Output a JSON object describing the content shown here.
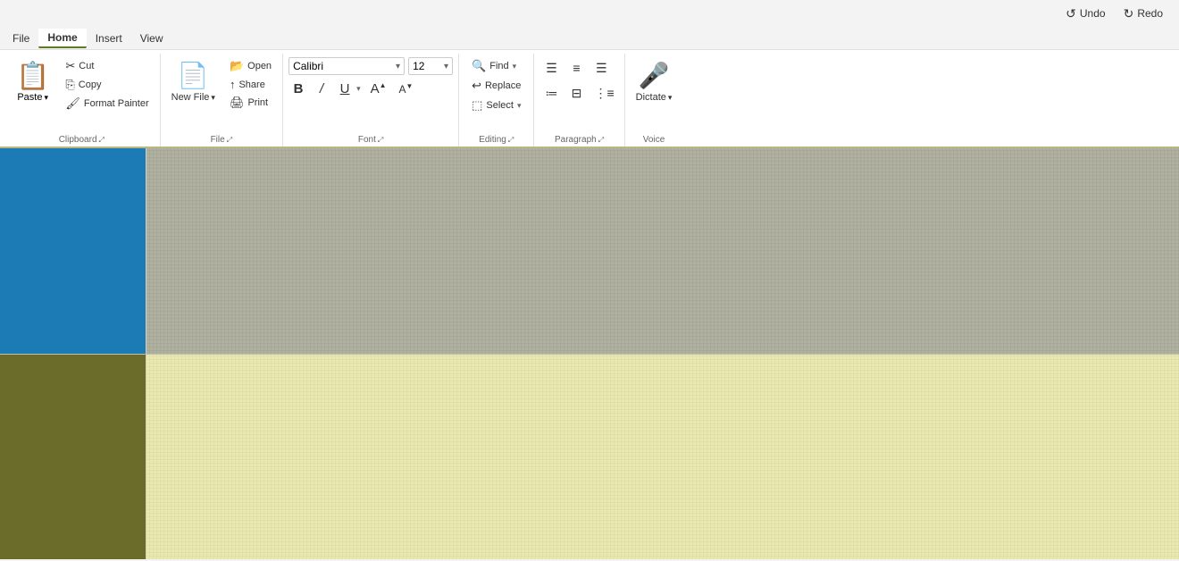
{
  "titlebar": {
    "undo_label": "Undo",
    "redo_label": "Redo"
  },
  "menubar": {
    "items": [
      "File",
      "Home",
      "Insert",
      "View"
    ]
  },
  "ribbon": {
    "clipboard": {
      "label": "Clipboard",
      "paste_label": "Paste",
      "cut_label": "Cut",
      "copy_label": "Copy",
      "format_painter_label": "Format Painter"
    },
    "file": {
      "label": "File",
      "new_file_label": "New File",
      "open_label": "Open",
      "share_label": "Share",
      "print_label": "Print"
    },
    "font": {
      "label": "Font",
      "font_name": "Calibri",
      "font_size": "12",
      "bold_label": "B",
      "italic_label": "/",
      "underline_label": "U",
      "grow_label": "A",
      "shrink_label": "A"
    },
    "editing": {
      "label": "Editing",
      "find_label": "Find",
      "replace_label": "Replace",
      "select_label": "Select"
    },
    "paragraph": {
      "label": "Paragraph"
    },
    "voice": {
      "label": "Voice",
      "dictate_label": "Dictate"
    }
  }
}
